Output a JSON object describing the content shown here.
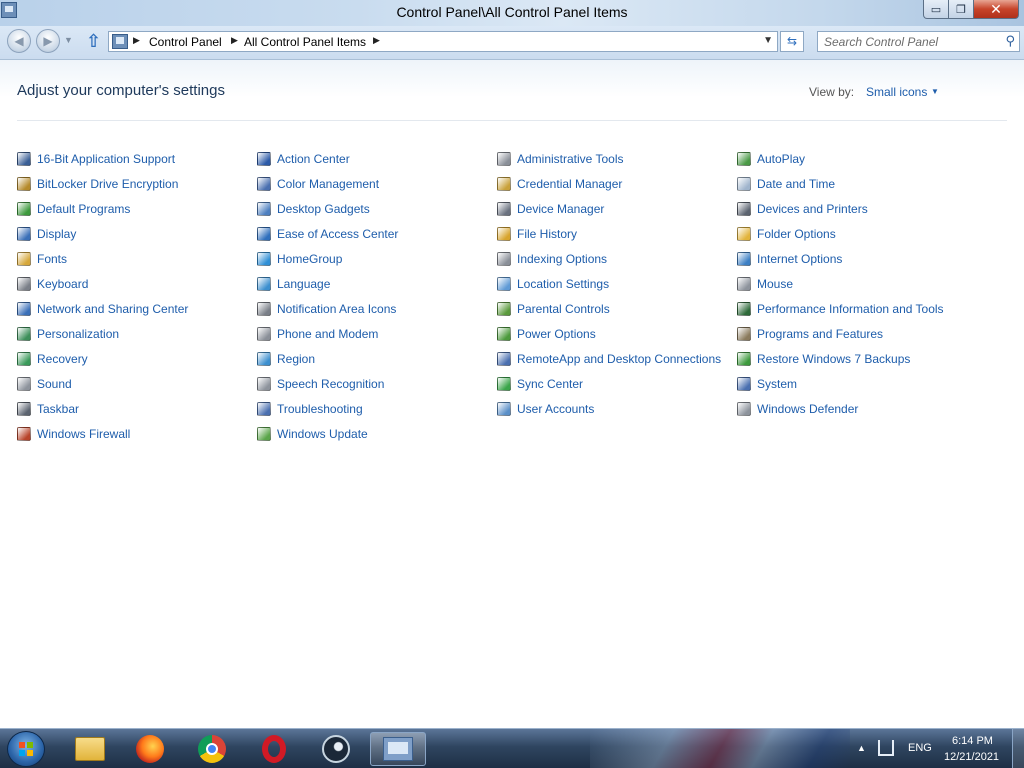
{
  "window": {
    "title": "Control Panel\\All Control Panel Items",
    "min_glyph": "▭",
    "max_glyph": "❐",
    "close_glyph": "✕"
  },
  "address": {
    "crumbs": [
      "Control Panel",
      "All Control Panel Items"
    ],
    "search_placeholder": "Search Control Panel"
  },
  "header": {
    "title": "Adjust your computer's settings",
    "view_by_label": "View by:",
    "view_by_value": "Small icons"
  },
  "items": [
    {
      "label": "16-Bit Application Support",
      "icon": "application-icon",
      "color": "#3a5f96"
    },
    {
      "label": "Action Center",
      "icon": "flag-icon",
      "color": "#2c5aa8"
    },
    {
      "label": "Administrative Tools",
      "icon": "admin-tools-icon",
      "color": "#8a8f98"
    },
    {
      "label": "AutoPlay",
      "icon": "autoplay-icon",
      "color": "#4a9a46"
    },
    {
      "label": "BitLocker Drive Encryption",
      "icon": "bitlocker-icon",
      "color": "#b58a2a"
    },
    {
      "label": "Color Management",
      "icon": "color-management-icon",
      "color": "#4a6fb0"
    },
    {
      "label": "Credential Manager",
      "icon": "credential-icon",
      "color": "#c9a13a"
    },
    {
      "label": "Date and Time",
      "icon": "clock-icon",
      "color": "#9fb4cc"
    },
    {
      "label": "Default Programs",
      "icon": "default-programs-icon",
      "color": "#3d9a3d"
    },
    {
      "label": "Desktop Gadgets",
      "icon": "gadgets-icon",
      "color": "#4d7fc0"
    },
    {
      "label": "Device Manager",
      "icon": "device-manager-icon",
      "color": "#6b7280"
    },
    {
      "label": "Devices and Printers",
      "icon": "printer-icon",
      "color": "#5c6470"
    },
    {
      "label": "Display",
      "icon": "display-icon",
      "color": "#3a6fb8"
    },
    {
      "label": "Ease of Access Center",
      "icon": "ease-of-access-icon",
      "color": "#2f6fbd"
    },
    {
      "label": "File History",
      "icon": "file-history-icon",
      "color": "#d8a42c"
    },
    {
      "label": "Folder Options",
      "icon": "folder-icon",
      "color": "#e2b43b"
    },
    {
      "label": "Fonts",
      "icon": "fonts-icon",
      "color": "#d6a73a"
    },
    {
      "label": "HomeGroup",
      "icon": "homegroup-icon",
      "color": "#2f8fd6"
    },
    {
      "label": "Indexing Options",
      "icon": "indexing-icon",
      "color": "#8a8f98"
    },
    {
      "label": "Internet Options",
      "icon": "internet-options-icon",
      "color": "#3c7fc4"
    },
    {
      "label": "Keyboard",
      "icon": "keyboard-icon",
      "color": "#7a7f88"
    },
    {
      "label": "Language",
      "icon": "language-icon",
      "color": "#3c8fcf"
    },
    {
      "label": "Location Settings",
      "icon": "location-icon",
      "color": "#5f9ad6"
    },
    {
      "label": "Mouse",
      "icon": "mouse-icon",
      "color": "#8d939c"
    },
    {
      "label": "Network and Sharing Center",
      "icon": "network-icon",
      "color": "#3a6fb8"
    },
    {
      "label": "Notification Area Icons",
      "icon": "notification-icon",
      "color": "#7a7f88"
    },
    {
      "label": "Parental Controls",
      "icon": "parental-controls-icon",
      "color": "#5a9a3c"
    },
    {
      "label": "Performance Information and Tools",
      "icon": "performance-icon",
      "color": "#2e6b3a"
    },
    {
      "label": "Personalization",
      "icon": "personalization-icon",
      "color": "#3d8f5a"
    },
    {
      "label": "Phone and Modem",
      "icon": "phone-icon",
      "color": "#8a8f98"
    },
    {
      "label": "Power Options",
      "icon": "power-icon",
      "color": "#4c9a3c"
    },
    {
      "label": "Programs and Features",
      "icon": "programs-icon",
      "color": "#8a7a5c"
    },
    {
      "label": "Recovery",
      "icon": "recovery-icon",
      "color": "#3a9a5a"
    },
    {
      "label": "Region",
      "icon": "region-icon",
      "color": "#3c8fcf"
    },
    {
      "label": "RemoteApp and Desktop Connections",
      "icon": "remoteapp-icon",
      "color": "#4a6fb0"
    },
    {
      "label": "Restore Windows 7 Backups",
      "icon": "restore-icon",
      "color": "#3d9a3d"
    },
    {
      "label": "Sound",
      "icon": "sound-icon",
      "color": "#8d939c"
    },
    {
      "label": "Speech Recognition",
      "icon": "microphone-icon",
      "color": "#8d939c"
    },
    {
      "label": "Sync Center",
      "icon": "sync-icon",
      "color": "#3aa54a"
    },
    {
      "label": "System",
      "icon": "system-icon",
      "color": "#4a6fb0"
    },
    {
      "label": "Taskbar",
      "icon": "taskbar-icon",
      "color": "#5c6470"
    },
    {
      "label": "Troubleshooting",
      "icon": "troubleshooting-icon",
      "color": "#4a6fb0"
    },
    {
      "label": "User Accounts",
      "icon": "user-accounts-icon",
      "color": "#5a8fc8"
    },
    {
      "label": "Windows Defender",
      "icon": "defender-icon",
      "color": "#8d939c"
    },
    {
      "label": "Windows Firewall",
      "icon": "firewall-icon",
      "color": "#b8442a"
    },
    {
      "label": "Windows Update",
      "icon": "windows-update-icon",
      "color": "#5aa54a"
    }
  ],
  "taskbar": {
    "apps": [
      "explorer-icon",
      "firefox-icon",
      "chrome-icon",
      "opera-icon",
      "steam-icon",
      "control-panel-icon"
    ],
    "language": "ENG",
    "time": "6:14 PM",
    "date": "12/21/2021"
  }
}
